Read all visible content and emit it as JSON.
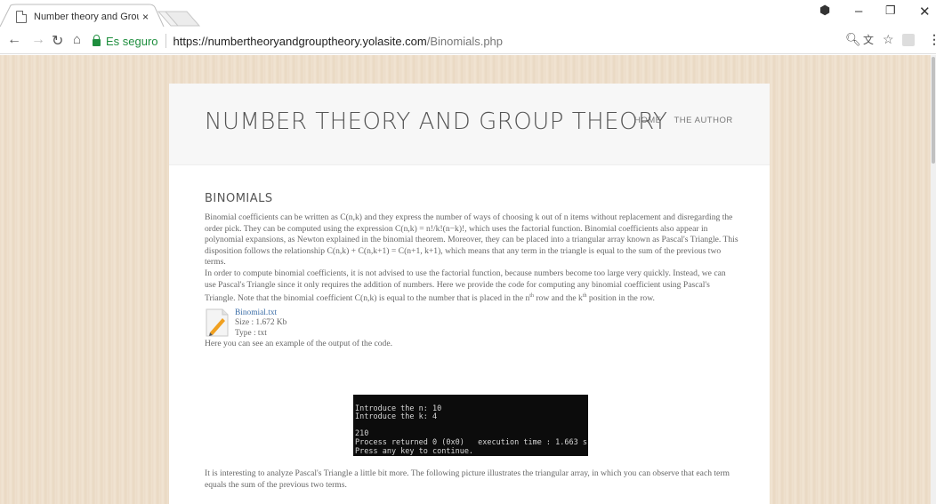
{
  "browser": {
    "tab_title": "Number theory and Grou",
    "tab_close": "×",
    "secure_label": "Es seguro",
    "url_host": "https://numbertheoryandgrouptheory.yolasite.com",
    "url_path": "/Binomials.php"
  },
  "site": {
    "title": "NUMBER THEORY AND GROUP THEORY",
    "nav": [
      "HOME",
      "THE AUTHOR"
    ]
  },
  "section": {
    "title": "BINOMIALS",
    "paragraph1": "Binomial coefficients can be written as C(n,k) and they express the number of ways of choosing k out of n items without replacement and disregarding the order pick. They can be computed using the expression C(n,k) = n!/k!(n−k)!, which uses the factorial function. Binomial coefficients also appear in polynomial expansions, as Newton explained in the binomial theorem. Moreover, they can be placed into a triangular array known as Pascal's Triangle. This disposition follows the relationship C(n,k) + C(n,k+1) = C(n+1, k+1), which means that any term in the triangle is equal to the sum of the previous two terms.",
    "paragraph2_a": "In order to compute binomial coefficients, it is not advised to use the factorial function, because numbers become too large very quickly. Instead, we can use Pascal's Triangle since it only requires the addition of numbers. Here we provide the code for computing any binomial coefficient using Pascal's Triangle. Note that the binomial coefficient C(n,k) is equal to the number that is placed in the n",
    "sup_th1": "th",
    "paragraph2_b": " row and the k",
    "sup_th2": "th",
    "paragraph2_c": " position in the row.",
    "file": {
      "name": "Binomial.txt",
      "size": "Size : 1.672 Kb",
      "type": "Type : txt"
    },
    "example_intro": "Here you can see an example of the output of the code.",
    "terminal_lines": [
      "Introduce the n: 10",
      "Introduce the k: 4",
      "",
      "210",
      "Process returned 0 (0x0)   execution time : 1.663 s",
      "Press any key to continue."
    ],
    "after_text": "It is interesting to analyze Pascal's Triangle a little bit more. The following picture illustrates the triangular array, in which you can observe that each term equals the sum of the previous two terms."
  },
  "colors": {
    "secure_green": "#1e8e3e",
    "link_blue": "#3d6fa8",
    "background_beige": "#ecdcc8"
  }
}
